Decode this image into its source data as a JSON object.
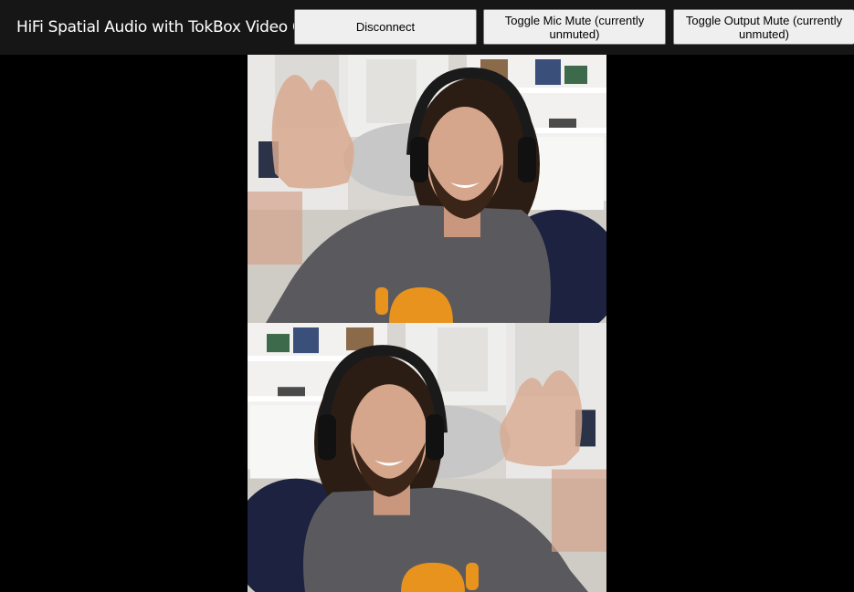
{
  "app": {
    "title": "HiFi Spatial Audio with TokBox Video Chat"
  },
  "toolbar": {
    "disconnect_label": "Disconnect",
    "mic_mute_label": "Toggle Mic Mute (currently unmuted)",
    "output_mute_label": "Toggle Output Mute (currently unmuted)"
  },
  "videos": [
    {
      "name": "local-participant-video",
      "mirrored": false
    },
    {
      "name": "remote-participant-video",
      "mirrored": true
    }
  ],
  "colors": {
    "background": "#000000",
    "topbar": "#161616",
    "button_bg": "#efefef",
    "shirt": "#5a5a5e",
    "logo_orange": "#e8931e"
  }
}
